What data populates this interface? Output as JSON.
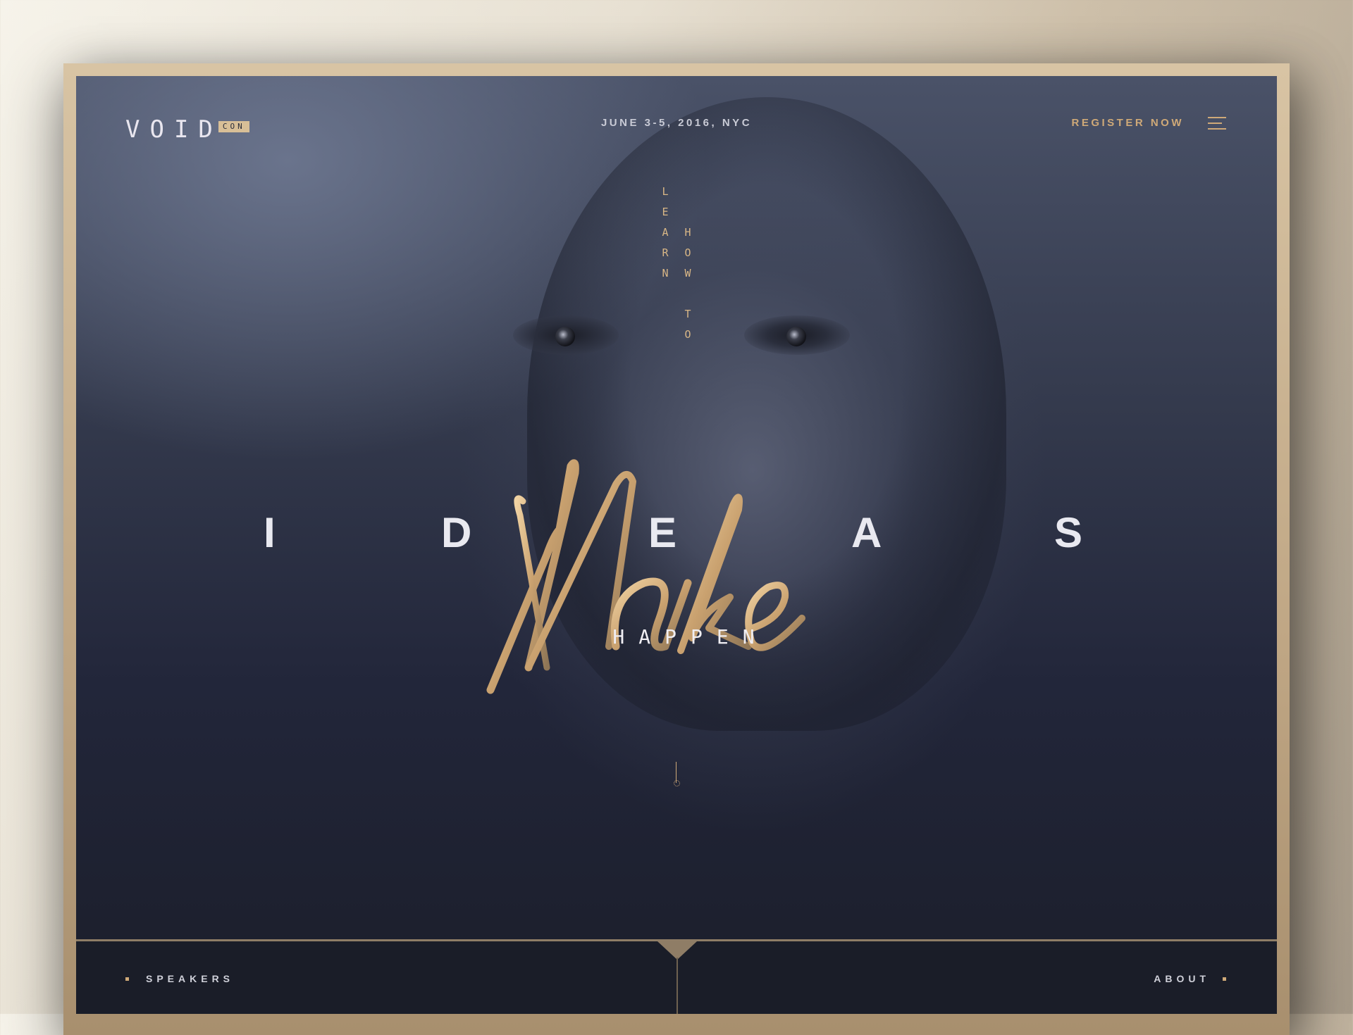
{
  "header": {
    "logo_main": "VOID",
    "logo_badge": "CON",
    "date": "JUNE 3-5, 2016, NYC",
    "register_label": "REGISTER NOW",
    "menu_icon": "hamburger-menu-icon"
  },
  "hero": {
    "vertical_left": [
      "L",
      "E",
      "A",
      "R",
      "N"
    ],
    "vertical_right": [
      "H",
      "O",
      "W",
      "",
      "T",
      "O"
    ],
    "ideas_letters": [
      "I",
      "D",
      "E",
      "A",
      "S"
    ],
    "script_word": "Make",
    "happen": "HAPPEN",
    "scroll_icon": "scroll-down-icon"
  },
  "bottom_nav": {
    "left_label": "SPEAKERS",
    "right_label": "ABOUT"
  },
  "colors": {
    "accent_gold": "#cfa978",
    "background_dark": "#1b1e2a",
    "frame": "#c9b392"
  }
}
